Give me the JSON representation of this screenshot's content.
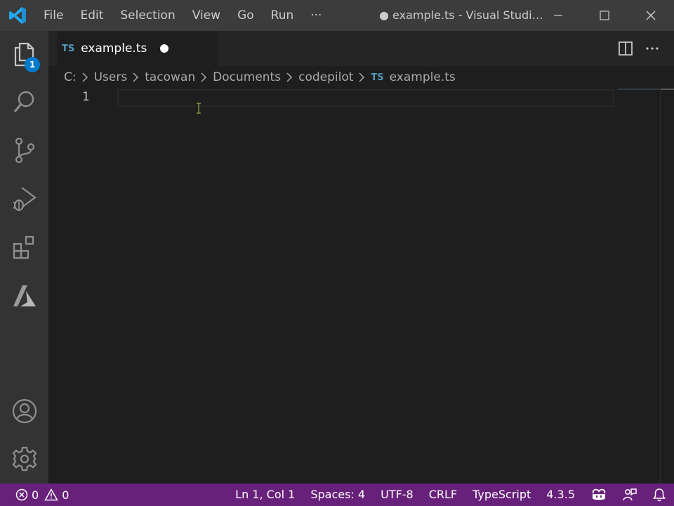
{
  "titlebar": {
    "menu": [
      "File",
      "Edit",
      "Selection",
      "View",
      "Go",
      "Run",
      "···"
    ],
    "window_title": "● example.ts - Visual Studi…"
  },
  "activitybar": {
    "explorer_badge": "1",
    "icons": [
      "files-icon",
      "search-icon",
      "source-control-icon",
      "run-debug-icon",
      "extensions-icon",
      "azure-icon",
      "account-icon",
      "gear-icon"
    ]
  },
  "tab": {
    "icon_text": "TS",
    "label": "example.ts"
  },
  "breadcrumb": {
    "segments": [
      "C:",
      "Users",
      "tacowan",
      "Documents",
      "codepilot"
    ],
    "file_icon_text": "TS",
    "file": "example.ts"
  },
  "editor": {
    "line_numbers": [
      "1"
    ]
  },
  "statusbar": {
    "errors": "0",
    "warnings": "0",
    "position": "Ln 1, Col 1",
    "indentation": "Spaces: 4",
    "encoding": "UTF-8",
    "eol": "CRLF",
    "language": "TypeScript",
    "version": "4.3.5"
  },
  "colors": {
    "titlebar": "#3c3c3c",
    "activitybar": "#333333",
    "editor_bg": "#1e1e1e",
    "statusbar": "#68217a",
    "accent_badge": "#007acc",
    "ts_icon": "#519aba"
  }
}
